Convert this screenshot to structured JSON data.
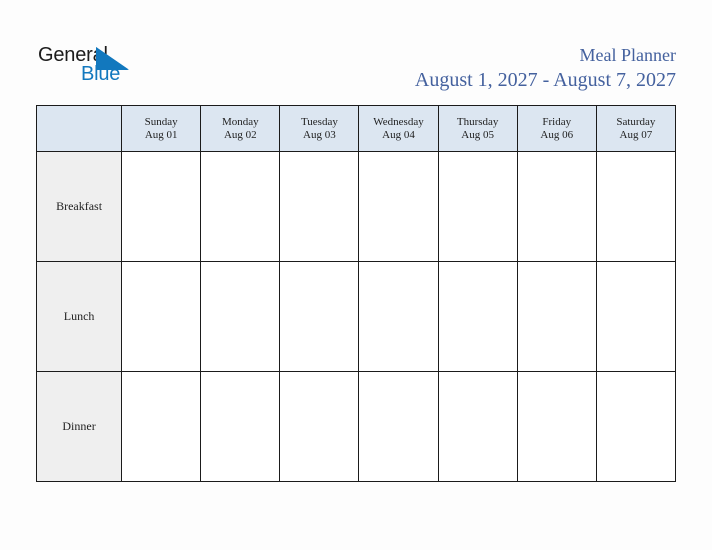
{
  "logo": {
    "word_one": "General",
    "word_two": "Blue",
    "triangle_icon": "triangle-icon",
    "blue": "#1278be",
    "dark": "#1c1c1c"
  },
  "header": {
    "title": "Meal Planner",
    "date_range": "August 1, 2027 - August 7, 2027",
    "title_color": "#44619e"
  },
  "table": {
    "corner_label": "",
    "header_bg": "#dce6f1",
    "label_bg": "#efefef",
    "border_color": "#1b1b1b",
    "columns": [
      {
        "day": "Sunday",
        "date": "Aug 01"
      },
      {
        "day": "Monday",
        "date": "Aug 02"
      },
      {
        "day": "Tuesday",
        "date": "Aug 03"
      },
      {
        "day": "Wednesday",
        "date": "Aug 04"
      },
      {
        "day": "Thursday",
        "date": "Aug 05"
      },
      {
        "day": "Friday",
        "date": "Aug 06"
      },
      {
        "day": "Saturday",
        "date": "Aug 07"
      }
    ],
    "rows": [
      {
        "label": "Breakfast",
        "cells": [
          "",
          "",
          "",
          "",
          "",
          "",
          ""
        ]
      },
      {
        "label": "Lunch",
        "cells": [
          "",
          "",
          "",
          "",
          "",
          "",
          ""
        ]
      },
      {
        "label": "Dinner",
        "cells": [
          "",
          "",
          "",
          "",
          "",
          "",
          ""
        ]
      }
    ]
  }
}
